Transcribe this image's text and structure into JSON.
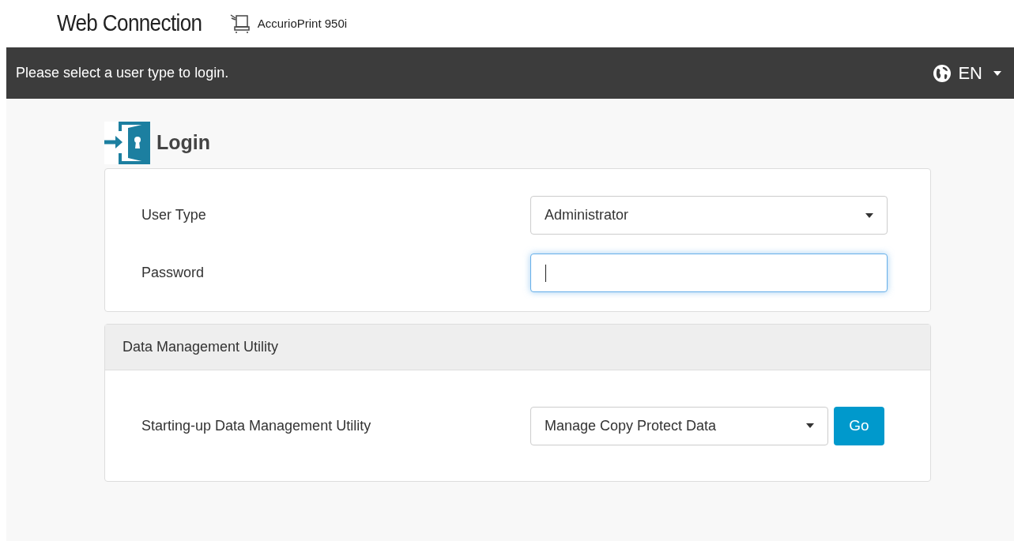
{
  "header": {
    "brand": "Web Connection",
    "device": "AccurioPrint 950i"
  },
  "nav_bar": {
    "message": "Please select a user type to login.",
    "language": "EN"
  },
  "login": {
    "title": "Login",
    "fields": [
      {
        "kind": "select",
        "label": "User Type",
        "value": "Administrator",
        "focused": false
      },
      {
        "kind": "password",
        "label": "Password",
        "focused": true
      }
    ]
  },
  "utility": {
    "title": "Data Management Utility",
    "label": "Starting-up Data Management Utility",
    "value": "Manage Copy Protect Data",
    "button": "Go"
  }
}
